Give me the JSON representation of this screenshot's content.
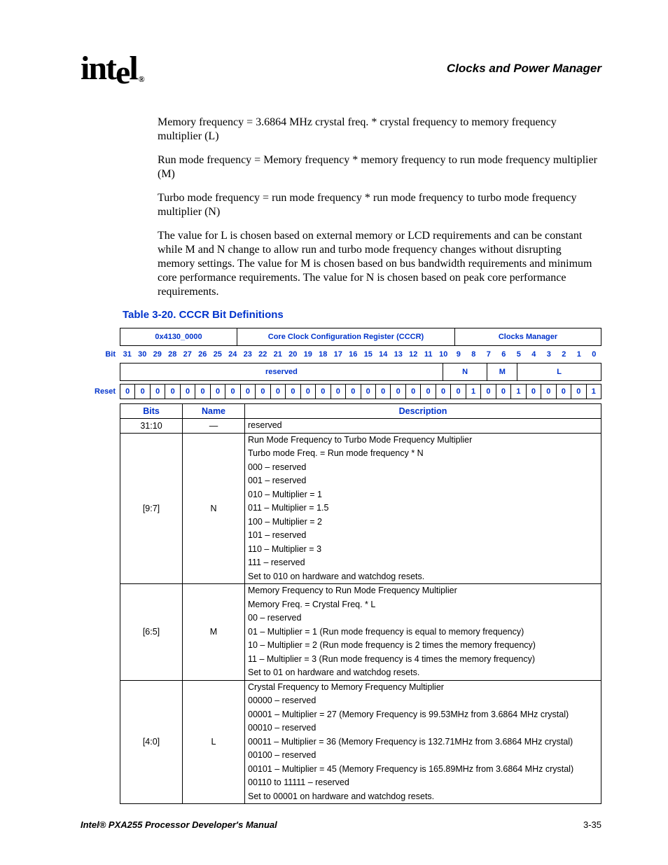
{
  "header": {
    "logo": "intel",
    "section": "Clocks and Power Manager"
  },
  "body": {
    "p1": "Memory frequency = 3.6864 MHz crystal freq. * crystal frequency to memory frequency multiplier (L)",
    "p2": "Run mode frequency = Memory frequency * memory frequency to run mode frequency multiplier (M)",
    "p3": "Turbo mode frequency = run mode frequency * run mode frequency to turbo mode frequency multiplier (N)",
    "p4": "The value for L is chosen based on external memory or LCD requirements and can be constant while M and N change to allow run and turbo mode frequency changes without disrupting memory settings. The value for M is chosen based on bus bandwidth requirements and minimum core performance requirements. The value for N is chosen based on peak core performance requirements."
  },
  "table_caption": "Table 3-20. CCCR Bit Definitions",
  "register": {
    "address": "0x4130_0000",
    "name": "Core Clock Configuration Register (CCCR)",
    "manager": "Clocks Manager"
  },
  "labels": {
    "bit": "Bit",
    "reset": "Reset",
    "bits_col": "Bits",
    "name_col": "Name",
    "desc_col": "Description"
  },
  "bits": [
    "31",
    "30",
    "29",
    "28",
    "27",
    "26",
    "25",
    "24",
    "23",
    "22",
    "21",
    "20",
    "19",
    "18",
    "17",
    "16",
    "15",
    "14",
    "13",
    "12",
    "11",
    "10",
    "9",
    "8",
    "7",
    "6",
    "5",
    "4",
    "3",
    "2",
    "1",
    "0"
  ],
  "fields": {
    "reserved": "reserved",
    "n": "N",
    "m": "M",
    "l": "L"
  },
  "reset": [
    "0",
    "0",
    "0",
    "0",
    "0",
    "0",
    "0",
    "0",
    "0",
    "0",
    "0",
    "0",
    "0",
    "0",
    "0",
    "0",
    "0",
    "0",
    "0",
    "0",
    "0",
    "0",
    "0",
    "1",
    "0",
    "0",
    "1",
    "0",
    "0",
    "0",
    "0",
    "1"
  ],
  "rows": [
    {
      "bits": "31:10",
      "name": "—",
      "desc": [
        "reserved"
      ]
    },
    {
      "bits": "[9:7]",
      "name": "N",
      "desc": [
        "Run Mode Frequency to Turbo Mode Frequency Multiplier",
        "Turbo mode Freq. = Run mode frequency * N",
        "000 – reserved",
        "001 – reserved",
        "010 – Multiplier = 1",
        "011 – Multiplier = 1.5",
        "100 – Multiplier = 2",
        "101 – reserved",
        "110 – Multiplier = 3",
        "111 – reserved",
        "Set to 010 on hardware and watchdog resets."
      ]
    },
    {
      "bits": "[6:5]",
      "name": "M",
      "desc": [
        "Memory Frequency to Run Mode Frequency Multiplier",
        "Memory Freq. = Crystal Freq. * L",
        "00 – reserved",
        "01 – Multiplier = 1 (Run mode frequency is equal to memory frequency)",
        "10 – Multiplier = 2 (Run mode frequency is 2 times the memory frequency)",
        "11 – Multiplier = 3 (Run mode frequency is 4 times the memory frequency)",
        "Set to 01 on hardware and watchdog resets."
      ]
    },
    {
      "bits": "[4:0]",
      "name": "L",
      "desc": [
        "Crystal Frequency to Memory Frequency Multiplier",
        "00000 – reserved",
        "00001 – Multiplier = 27 (Memory Frequency is 99.53MHz from 3.6864 MHz crystal)",
        "00010 – reserved",
        "00011 – Multiplier = 36 (Memory Frequency is 132.71MHz from 3.6864 MHz crystal)",
        "00100 – reserved",
        "00101 – Multiplier = 45 (Memory Frequency is 165.89MHz from 3.6864 MHz crystal)",
        "00110 to 11111 – reserved",
        "Set to 00001 on hardware and watchdog resets."
      ]
    }
  ],
  "footer": {
    "manual": "Intel® PXA255 Processor Developer's Manual",
    "page": "3-35"
  }
}
